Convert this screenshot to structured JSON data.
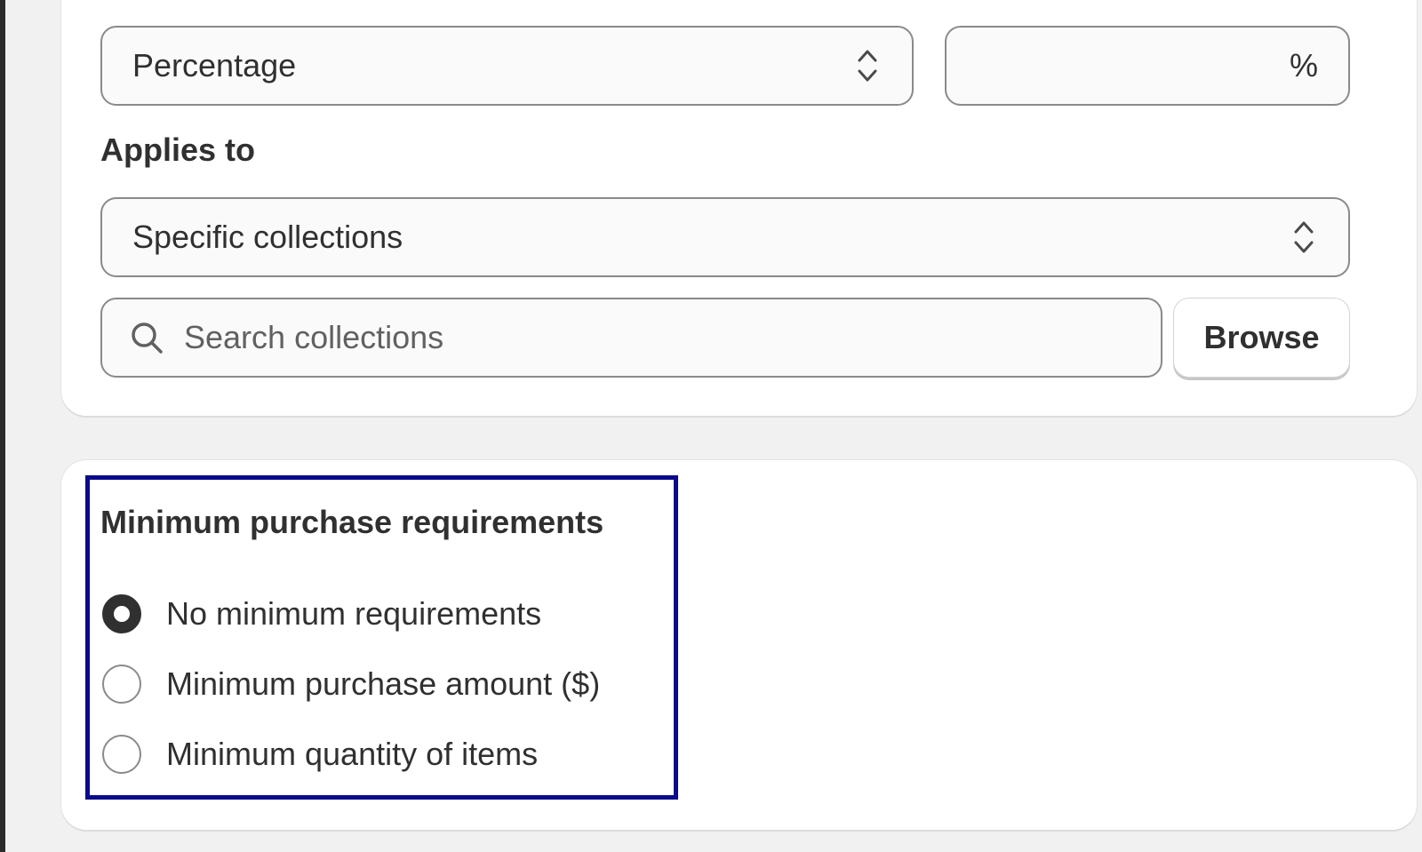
{
  "discount": {
    "type_select": {
      "selected": "Percentage"
    },
    "value_field": {
      "value": "",
      "suffix": "%"
    }
  },
  "applies_to": {
    "label": "Applies to",
    "select": {
      "selected": "Specific collections"
    },
    "search": {
      "placeholder": "Search collections",
      "value": ""
    },
    "browse_label": "Browse"
  },
  "minimum_requirements": {
    "title": "Minimum purchase requirements",
    "options": [
      {
        "label": "No minimum requirements",
        "checked": true
      },
      {
        "label": "Minimum purchase amount ($)",
        "checked": false
      },
      {
        "label": "Minimum quantity of items",
        "checked": false
      }
    ]
  },
  "icons": {
    "select_chevron": "chevron-up-down-icon",
    "search": "search-icon"
  },
  "colors": {
    "highlight_border": "#0a0a8a",
    "page_background": "#f1f1f1",
    "card_background": "#ffffff",
    "text": "#303030"
  }
}
